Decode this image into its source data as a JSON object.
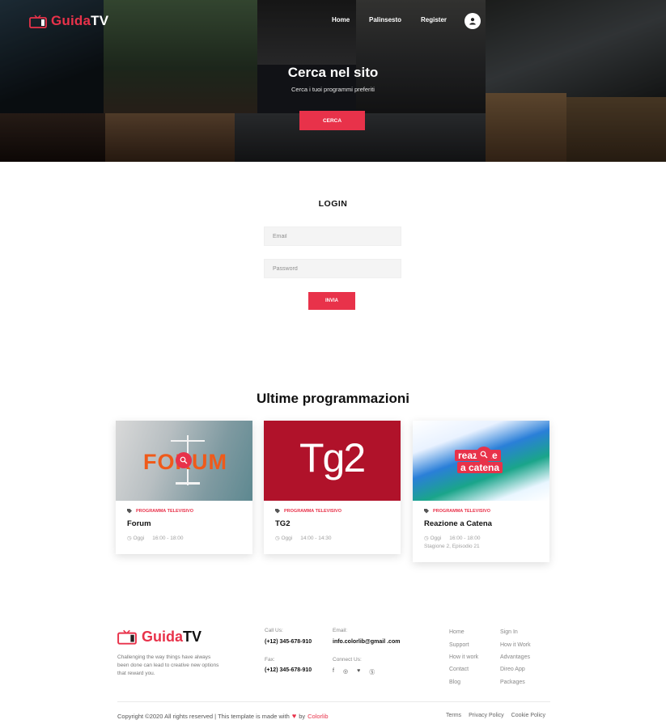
{
  "brand": {
    "name_part1": "Guida",
    "name_part2": "TV",
    "accent_color": "#e8324a"
  },
  "nav": {
    "home": "Home",
    "palinsesto": "Palinsesto",
    "register": "Register",
    "user_icon": "user-icon"
  },
  "hero": {
    "title": "Cerca nel sito",
    "subtitle": "Cerca i tuoi programmi preferiti",
    "button": "CERCA"
  },
  "login": {
    "title": "LOGIN",
    "email_placeholder": "Email",
    "password_placeholder": "Password",
    "submit": "INVIA"
  },
  "section": {
    "title": "Ultime programmazioni"
  },
  "cards": [
    {
      "category": "PROGRAMMA TELEVISIVO",
      "title": "Forum",
      "day": "Oggi",
      "time": "16:00 - 18:00",
      "episode": "",
      "thumb_text": "FORUM"
    },
    {
      "category": "PROGRAMMA TELEVISIVO",
      "title": "TG2",
      "day": "Oggi",
      "time": "14:00 - 14:30",
      "episode": "",
      "thumb_text": "Tg2"
    },
    {
      "category": "PROGRAMMA TELEVISIVO",
      "title": "Reazione a Catena",
      "day": "Oggi",
      "time": "16:00 - 18:00",
      "episode": "Stagione 2, Episodio 21",
      "thumb_text_1": "reazione",
      "thumb_text_2": "a catena"
    }
  ],
  "footer": {
    "description": "Challenging the way things have always been done can lead to creative new options that reward you.",
    "call_label": "Call Us:",
    "call_value": "(+12) 345-678-910",
    "fax_label": "Fax:",
    "fax_value": "(+12) 345-678-910",
    "email_label": "Email:",
    "email_value": "info.colorlib@gmail .com",
    "connect_label": "Connect Us:",
    "social": [
      "facebook-icon",
      "instagram-icon",
      "twitter-icon",
      "skype-icon"
    ],
    "links_col1": [
      "Home",
      "Support",
      "How it work",
      "Contact",
      "Blog"
    ],
    "links_col2": [
      "Sign In",
      "How it Work",
      "Advantages",
      "Direo App",
      "Packages"
    ],
    "copyright_prefix": "Copyright ©2020 All rights reserved | This template is made with",
    "copyright_by": "by",
    "copyright_brand": "Colorlib",
    "bottom_links": [
      "Terms",
      "Privacy Policy",
      "Cookie Policy"
    ]
  }
}
